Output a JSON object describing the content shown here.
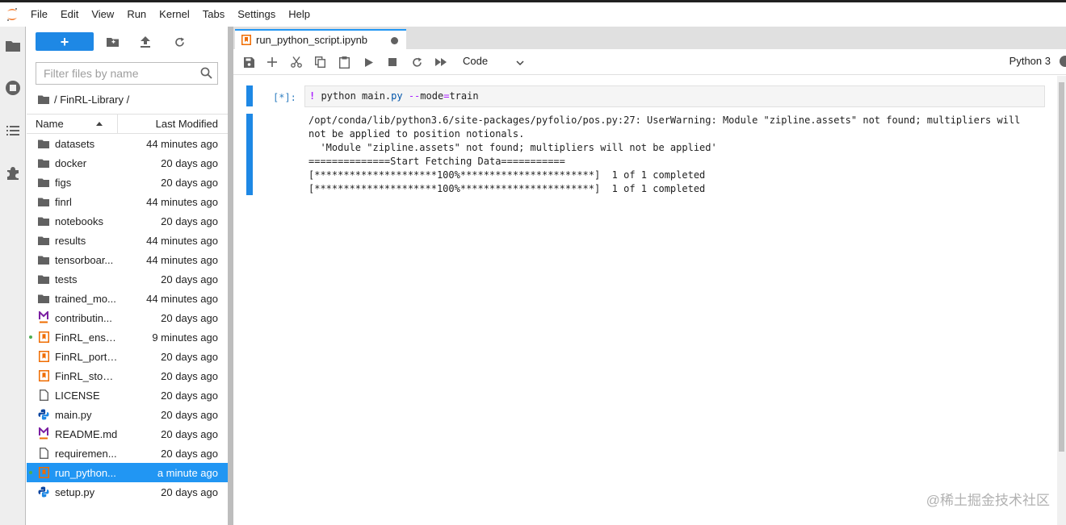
{
  "menubar": {
    "items": [
      "File",
      "Edit",
      "View",
      "Run",
      "Kernel",
      "Tabs",
      "Settings",
      "Help"
    ]
  },
  "filebrowser": {
    "new_label": "+",
    "filter_placeholder": "Filter files by name",
    "breadcrumb": "/ FinRL-Library /",
    "header_name": "Name",
    "header_modified": "Last Modified",
    "files": [
      {
        "name": "datasets",
        "modified": "44 minutes ago",
        "icon": "folder-icon"
      },
      {
        "name": "docker",
        "modified": "20 days ago",
        "icon": "folder-icon"
      },
      {
        "name": "figs",
        "modified": "20 days ago",
        "icon": "folder-icon"
      },
      {
        "name": "finrl",
        "modified": "44 minutes ago",
        "icon": "folder-icon"
      },
      {
        "name": "notebooks",
        "modified": "20 days ago",
        "icon": "folder-icon"
      },
      {
        "name": "results",
        "modified": "44 minutes ago",
        "icon": "folder-icon"
      },
      {
        "name": "tensorboar...",
        "modified": "44 minutes ago",
        "icon": "folder-icon"
      },
      {
        "name": "tests",
        "modified": "20 days ago",
        "icon": "folder-icon"
      },
      {
        "name": "trained_mo...",
        "modified": "44 minutes ago",
        "icon": "folder-icon"
      },
      {
        "name": "contributin...",
        "modified": "20 days ago",
        "icon": "markdown-icon"
      },
      {
        "name": "FinRL_ense...",
        "modified": "9 minutes ago",
        "icon": "notebook-icon",
        "running": true
      },
      {
        "name": "FinRL_portf...",
        "modified": "20 days ago",
        "icon": "notebook-icon"
      },
      {
        "name": "FinRL_stock...",
        "modified": "20 days ago",
        "icon": "notebook-icon"
      },
      {
        "name": "LICENSE",
        "modified": "20 days ago",
        "icon": "file-icon"
      },
      {
        "name": "main.py",
        "modified": "20 days ago",
        "icon": "python-icon"
      },
      {
        "name": "README.md",
        "modified": "20 days ago",
        "icon": "markdown-icon"
      },
      {
        "name": "requiremen...",
        "modified": "20 days ago",
        "icon": "file-icon"
      },
      {
        "name": "run_python...",
        "modified": "a minute ago",
        "icon": "notebook-icon",
        "running": true,
        "selected": true
      },
      {
        "name": "setup.py",
        "modified": "20 days ago",
        "icon": "python-icon"
      }
    ]
  },
  "main": {
    "tab_label": "run_python_script.ipynb",
    "cell_type": "Code",
    "kernel": "Python 3",
    "cell": {
      "prompt": "[*]:",
      "source_bang": "!",
      "source_cmd": " python main.",
      "source_ext": "py",
      "source_op1": " --",
      "source_arg": "mode",
      "source_op2": "=",
      "source_val": "train",
      "output": "/opt/conda/lib/python3.6/site-packages/pyfolio/pos.py:27: UserWarning: Module \"zipline.assets\" not found; multipliers will not be applied to position notionals.\n  'Module \"zipline.assets\" not found; multipliers will not be applied'\n==============Start Fetching Data===========\n[*********************100%***********************]  1 of 1 completed\n[*********************100%***********************]  1 of 1 completed"
    }
  },
  "watermark": "@稀土掘金技术社区",
  "colors": {
    "accent": "#2196f3",
    "new_button": "#1e88e5",
    "collapser": "#1e88e5",
    "notebook_icon": "#ef6c00",
    "markdown_icon": "#7b1fa2",
    "running_dot": "#4caf50"
  }
}
